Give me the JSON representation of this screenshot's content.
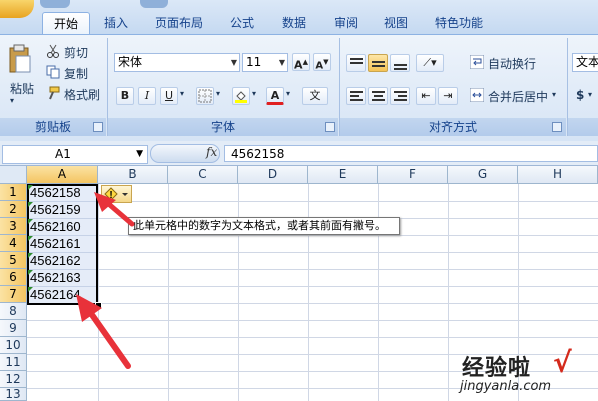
{
  "ribbon_tabs": [
    "开始",
    "插入",
    "页面布局",
    "公式",
    "数据",
    "审阅",
    "视图",
    "特色功能"
  ],
  "clipboard": {
    "paste": "粘贴",
    "cut": "剪切",
    "copy": "复制",
    "format_painter": "格式刷",
    "group_label": "剪贴板"
  },
  "font": {
    "name": "宋体",
    "size": "11",
    "grow": "A",
    "shrink": "A",
    "bold": "B",
    "italic": "I",
    "underline": "U",
    "font_color": "A",
    "wen": "文",
    "group_label": "字体"
  },
  "alignment": {
    "wrap_text": "自动换行",
    "merge_center": "合并后居中",
    "group_label": "对齐方式"
  },
  "number": {
    "format": "文本",
    "currency": "$"
  },
  "formula_bar": {
    "name_box": "A1",
    "fx": "fx",
    "content": "4562158"
  },
  "columns": [
    "A",
    "B",
    "C",
    "D",
    "E",
    "F",
    "G",
    "H"
  ],
  "rows": [
    "1",
    "2",
    "3",
    "4",
    "5",
    "6",
    "7",
    "8",
    "9",
    "10",
    "11",
    "12",
    "13"
  ],
  "cells": [
    "4562158",
    "4562159",
    "4562160",
    "4562161",
    "4562162",
    "4562163",
    "4562164"
  ],
  "error_tooltip": "此单元格中的数字为文本格式，或者其前面有撇号。",
  "watermark": {
    "title": "经验啦",
    "url": "jingyanla.com",
    "check": "√"
  },
  "colors": {
    "selection_header": "#f4c562",
    "arrow": "#e8323a",
    "error_triangle": "#2e8b2e"
  }
}
